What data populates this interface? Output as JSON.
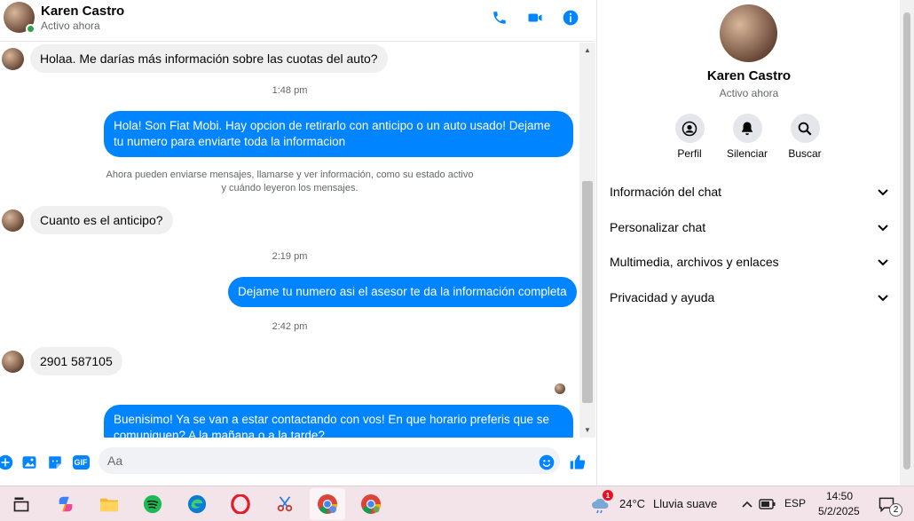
{
  "header": {
    "name": "Karen Castro",
    "status": "Activo ahora"
  },
  "messages": {
    "m1": "Holaa. Me darías más información sobre las cuotas del auto?",
    "ts1": "1:48 pm",
    "m2_line1": "Hola! Son Fiat Mobi. Hay opcion de retirarlo con anticipo o un auto usado! Dejame",
    "m2_line2": "tu numero para enviarte toda la informacion",
    "system_line1": "Ahora pueden enviarse mensajes, llamarse y ver información, como su estado activo",
    "system_line2": "y cuándo leyeron los mensajes.",
    "m3": "Cuanto es el anticipo?",
    "ts2": "2:19 pm",
    "m4": "Dejame tu numero asi el asesor te da la información completa",
    "ts3": "2:42 pm",
    "m5": "2901 587105",
    "m6_line1": "Buenisimo! Ya se van a estar contactando con vos! En que horario preferis que se",
    "m6_line2": "comuniquen? A la mañana o a la tarde?"
  },
  "composer": {
    "placeholder": "Aa",
    "gif_label": "GIF"
  },
  "panel": {
    "name": "Karen Castro",
    "status": "Activo ahora",
    "actions": [
      "Perfil",
      "Silenciar",
      "Buscar"
    ],
    "sections": [
      "Información del chat",
      "Personalizar chat",
      "Multimedia, archivos y enlaces",
      "Privacidad y ayuda"
    ]
  },
  "taskbar": {
    "weather_temp": "24°C",
    "weather_desc": "Lluvia suave",
    "weather_badge": "1",
    "lang": "ESP",
    "time": "14:50",
    "date": "5/2/2025",
    "notif_count": "2"
  },
  "colors": {
    "accent": "#0084ff",
    "incoming": "#f0f0f0",
    "online": "#31a24c",
    "taskbar": "#f3e4ea"
  }
}
